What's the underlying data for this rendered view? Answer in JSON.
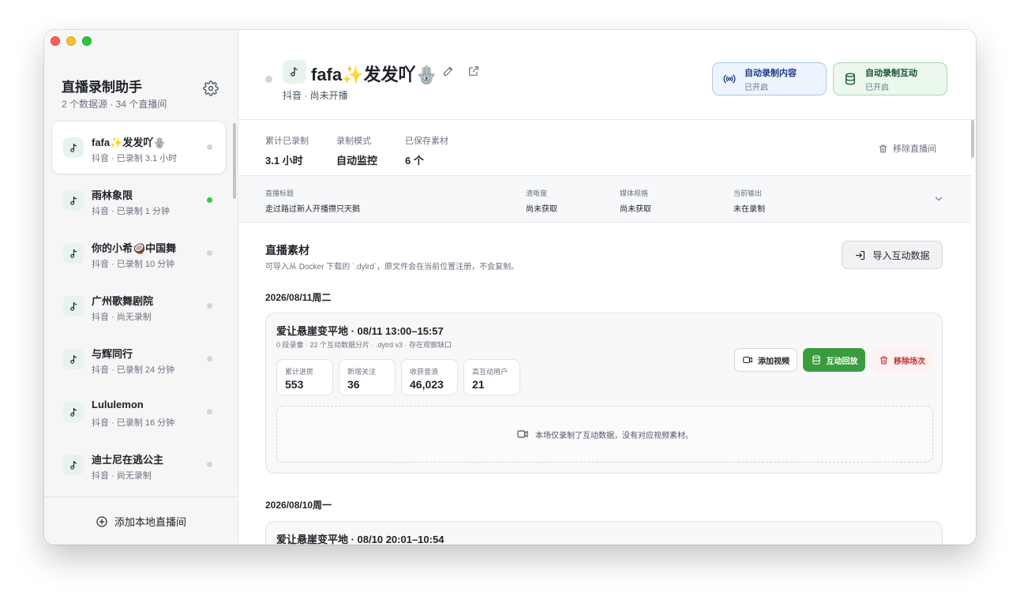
{
  "sidebar": {
    "title": "直播录制助手",
    "subtitle": "2 个数据源 · 34 个直播间",
    "items": [
      {
        "name": "fafa✨发发吖🪬",
        "meta": "抖音 · 已录制 3.1 小时",
        "live": false,
        "active": true
      },
      {
        "name": "雨林象限",
        "meta": "抖音 · 已录制 1 分钟",
        "live": true,
        "active": false
      },
      {
        "name": "你的小希🥥中国舞",
        "meta": "抖音 · 已录制 10 分钟",
        "live": false,
        "active": false
      },
      {
        "name": "广州歌舞剧院",
        "meta": "抖音 · 尚无录制",
        "live": false,
        "active": false
      },
      {
        "name": "与辉同行",
        "meta": "抖音 · 已录制 24 分钟",
        "live": false,
        "active": false
      },
      {
        "name": "Lululemon",
        "meta": "抖音 · 已录制 16 分钟",
        "live": false,
        "active": false
      },
      {
        "name": "迪士尼在逃公主",
        "meta": "抖音 · 尚无录制",
        "live": false,
        "active": false
      }
    ],
    "add_label": "添加本地直播间"
  },
  "header": {
    "title": "fafa✨发发吖🪬",
    "subtitle": "抖音 · 尚未开播",
    "toggle_content": {
      "label": "自动录制内容",
      "status": "已开启"
    },
    "toggle_interact": {
      "label": "自动录制互动",
      "status": "已开启"
    }
  },
  "stats": {
    "recorded": {
      "label": "累计已录制",
      "value": "3.1 小时"
    },
    "mode": {
      "label": "录制模式",
      "value": "自动监控"
    },
    "saved": {
      "label": "已保存素材",
      "value": "6 个"
    },
    "remove_label": "移除直播间"
  },
  "info": {
    "stream_title": {
      "label": "直播标题",
      "value": "走过路过新人开播攒只天鹅"
    },
    "quality": {
      "label": "清晰度",
      "value": "尚未获取"
    },
    "media": {
      "label": "媒体规格",
      "value": "尚未获取"
    },
    "output": {
      "label": "当前输出",
      "value": "未在录制"
    }
  },
  "materials": {
    "title": "直播素材",
    "subtitle": "可导入从 Docker 下载的 `.dylrd`，原文件会在当前位置注册，不会复制。",
    "import_label": "导入互动数据",
    "sessions": [
      {
        "date": "2026/08/11周二",
        "title": "爱让悬崖变平地 · 08/11 13:00–15:57",
        "meta": "0 段录像 · 22 个互动数据分片 · .dylrd v3 · 存在观察缺口",
        "stats": [
          {
            "label": "累计进房",
            "value": "553"
          },
          {
            "label": "新增关注",
            "value": "36"
          },
          {
            "label": "收获音浪",
            "value": "46,023"
          },
          {
            "label": "高互动用户",
            "value": "21"
          }
        ],
        "add_video": "添加视频",
        "replay": "互动回放",
        "remove": "移除场次",
        "empty_text": "本场仅录制了互动数据，没有对应视频素材。"
      },
      {
        "date": "2026/08/10周一",
        "title": "爱让悬崖变平地 · 08/10 20:01–10:54"
      }
    ]
  },
  "colors": {
    "accent_green": "#3a9c3f",
    "live_dot": "#2ecc40",
    "danger": "#c53030",
    "toggle_blue_bg": "#eef4fe",
    "toggle_green_bg": "#ecf8ee"
  },
  "icons": {
    "settings": "gear-icon",
    "room": "music-note-icon",
    "edit": "pencil-icon",
    "open": "external-link-icon",
    "broadcast": "broadcast-icon",
    "database": "database-icon",
    "trash": "trash-icon",
    "import": "import-icon",
    "video": "video-icon",
    "add": "plus-circle-icon",
    "expand": "chevron-down-icon"
  }
}
